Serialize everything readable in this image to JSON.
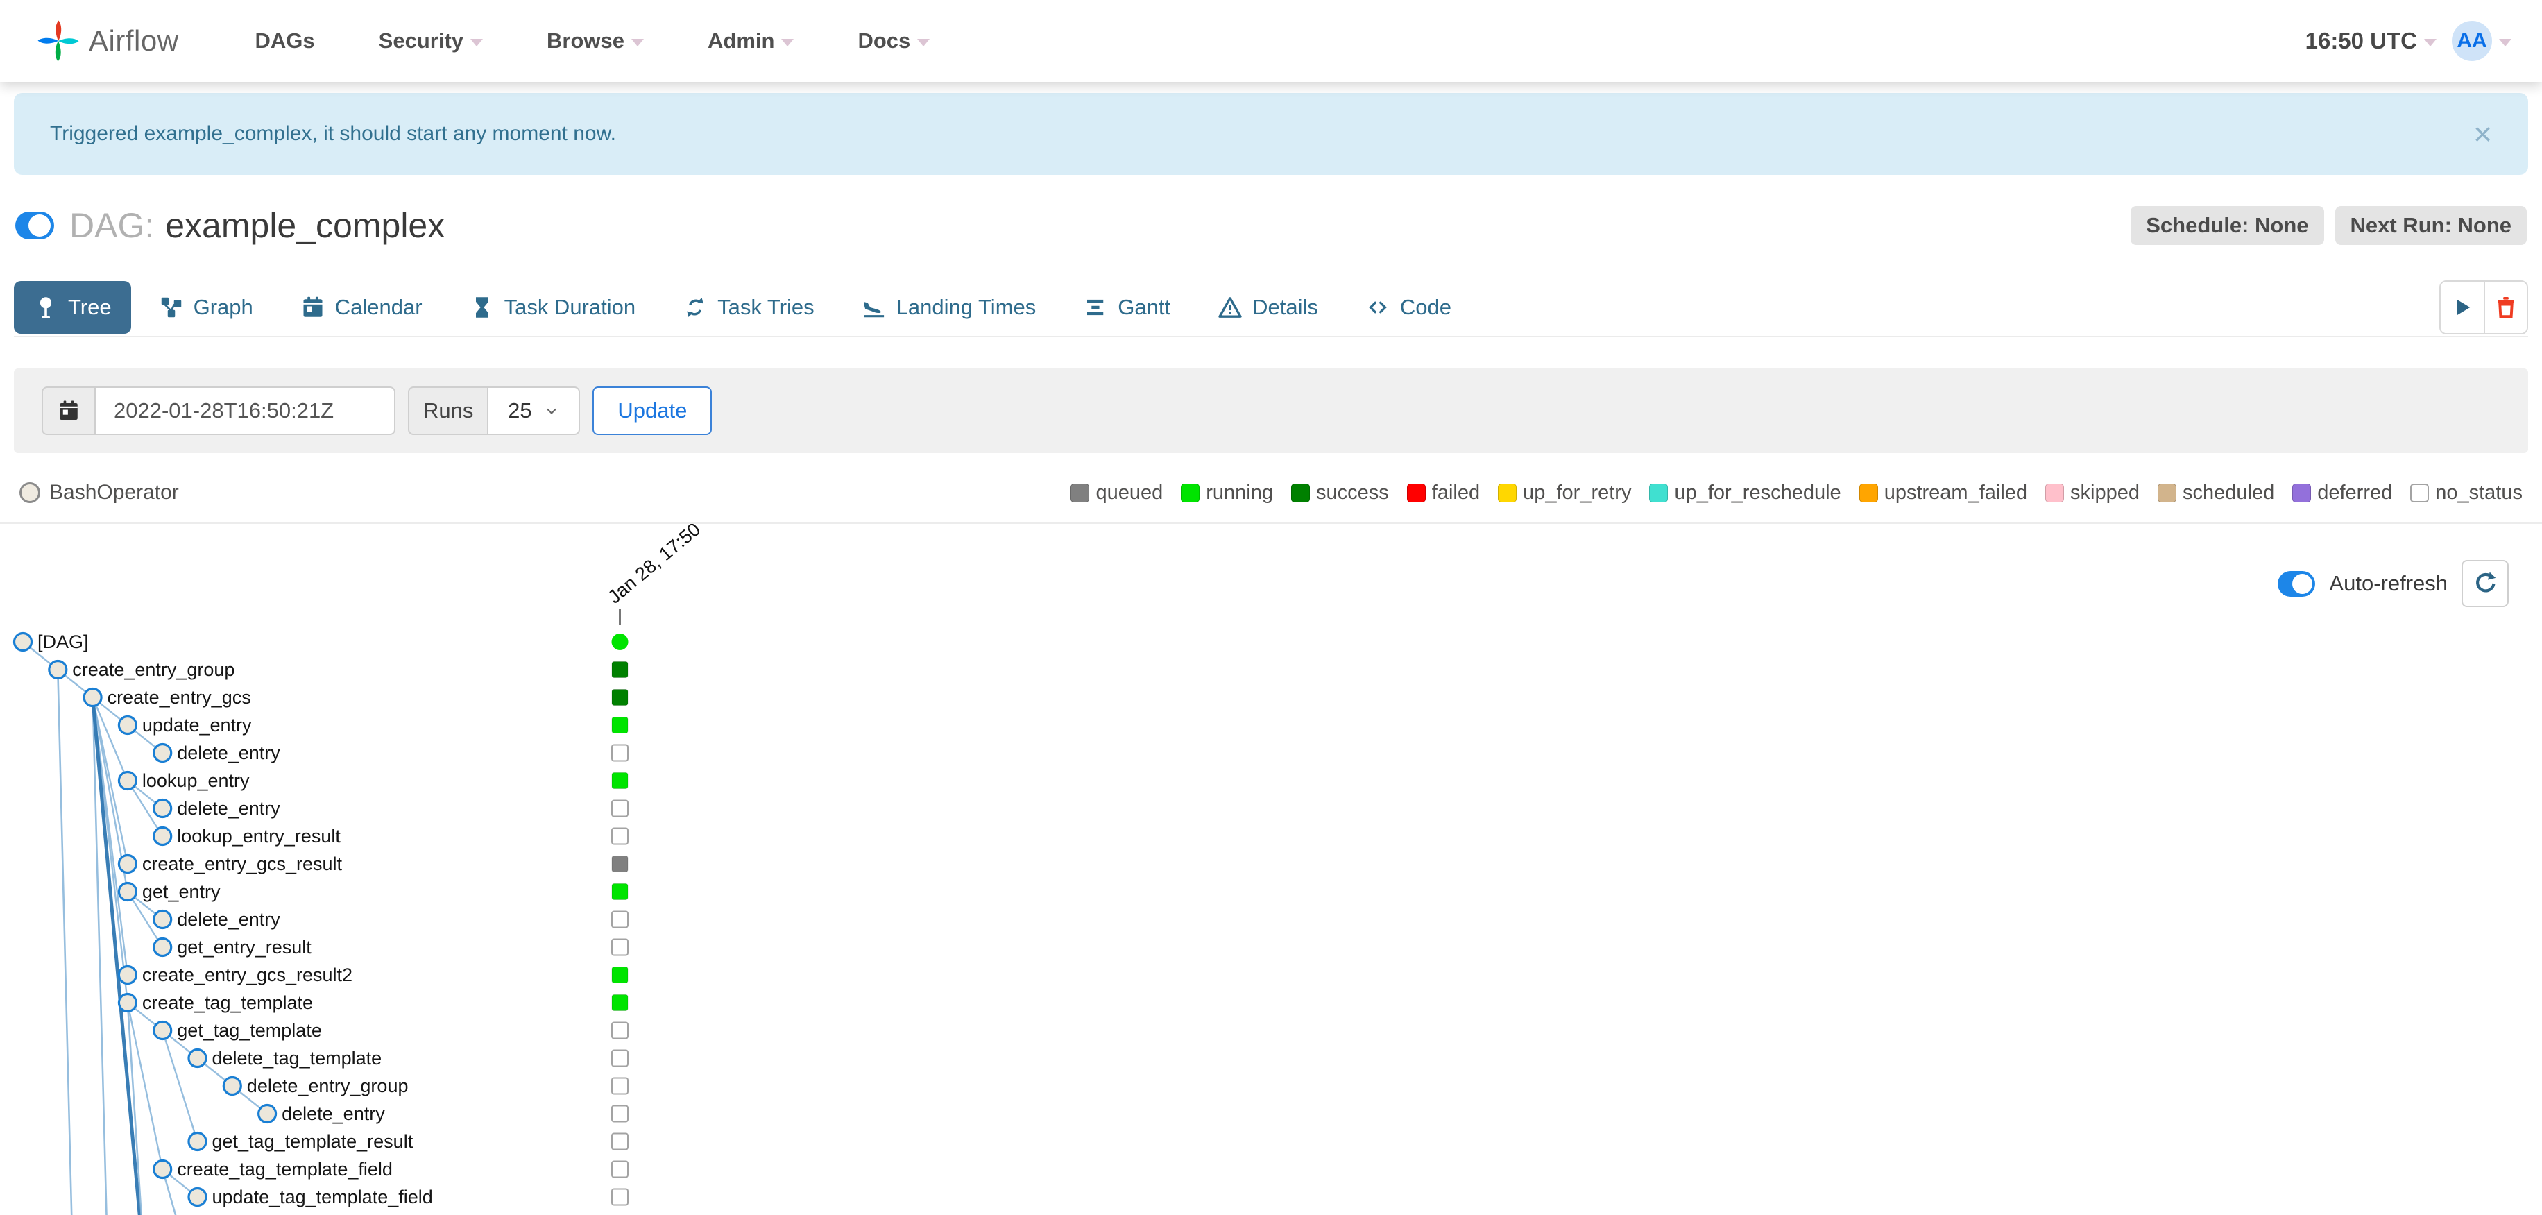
{
  "navbar": {
    "brand": "Airflow",
    "menus": [
      {
        "label": "DAGs",
        "caret": false
      },
      {
        "label": "Security",
        "caret": true
      },
      {
        "label": "Browse",
        "caret": true
      },
      {
        "label": "Admin",
        "caret": true
      },
      {
        "label": "Docs",
        "caret": true
      }
    ],
    "clock": "16:50 UTC",
    "avatar_initials": "AA"
  },
  "alert": {
    "message": "Triggered example_complex, it should start any moment now.",
    "close_glyph": "×"
  },
  "dag_header": {
    "prefix": "DAG:",
    "name": "example_complex",
    "badges": [
      {
        "label": "Schedule: None"
      },
      {
        "label": "Next Run: None"
      }
    ]
  },
  "tabs": [
    {
      "label": "Tree",
      "icon": "tree-pin-icon",
      "active": true
    },
    {
      "label": "Graph",
      "icon": "graph-icon",
      "active": false
    },
    {
      "label": "Calendar",
      "icon": "calendar-icon",
      "active": false
    },
    {
      "label": "Task Duration",
      "icon": "hourglass-icon",
      "active": false
    },
    {
      "label": "Task Tries",
      "icon": "retry-arrows-icon",
      "active": false
    },
    {
      "label": "Landing Times",
      "icon": "plane-landing-icon",
      "active": false
    },
    {
      "label": "Gantt",
      "icon": "gantt-bars-icon",
      "active": false
    },
    {
      "label": "Details",
      "icon": "warning-triangle-icon",
      "active": false
    },
    {
      "label": "Code",
      "icon": "code-brackets-icon",
      "active": false
    }
  ],
  "filter": {
    "date_value": "2022-01-28T16:50:21Z",
    "runs_label": "Runs",
    "runs_value": "25",
    "update_label": "Update"
  },
  "legend": {
    "operators": [
      {
        "label": "BashOperator",
        "fill": "#f0ebe1",
        "stroke": "#8b8b8b"
      }
    ],
    "statuses": [
      {
        "label": "queued",
        "color": "#808080"
      },
      {
        "label": "running",
        "color": "#00e400"
      },
      {
        "label": "success",
        "color": "#008000"
      },
      {
        "label": "failed",
        "color": "#ff0000"
      },
      {
        "label": "up_for_retry",
        "color": "#ffd700"
      },
      {
        "label": "up_for_reschedule",
        "color": "#40e0d0"
      },
      {
        "label": "upstream_failed",
        "color": "#ffa500"
      },
      {
        "label": "skipped",
        "color": "#ffc0cb"
      },
      {
        "label": "scheduled",
        "color": "#d2b48c"
      },
      {
        "label": "deferred",
        "color": "#9370db"
      },
      {
        "label": "no_status",
        "color": "#ffffff"
      }
    ]
  },
  "tree": {
    "auto_refresh_label": "Auto-refresh",
    "column_date": "Jan 28, 17:50",
    "dag_run_status": "running",
    "nodes": [
      {
        "label": "[DAG]",
        "level": 0,
        "status": "running",
        "hidden_children": false
      },
      {
        "label": "create_entry_group",
        "level": 1,
        "status": "success",
        "hidden_children": true
      },
      {
        "label": "create_entry_gcs",
        "level": 2,
        "status": "success",
        "hidden_children": true
      },
      {
        "label": "update_entry",
        "level": 3,
        "status": "running",
        "hidden_children": false
      },
      {
        "label": "delete_entry",
        "level": 4,
        "status": "no_status",
        "hidden_children": false
      },
      {
        "label": "lookup_entry",
        "level": 3,
        "status": "running",
        "hidden_children": false
      },
      {
        "label": "delete_entry",
        "level": 4,
        "status": "no_status",
        "hidden_children": false
      },
      {
        "label": "lookup_entry_result",
        "level": 4,
        "status": "no_status",
        "hidden_children": false
      },
      {
        "label": "create_entry_gcs_result",
        "level": 3,
        "status": "queued",
        "hidden_children": false
      },
      {
        "label": "get_entry",
        "level": 3,
        "status": "running",
        "hidden_children": false
      },
      {
        "label": "delete_entry",
        "level": 4,
        "status": "no_status",
        "hidden_children": false
      },
      {
        "label": "get_entry_result",
        "level": 4,
        "status": "no_status",
        "hidden_children": false
      },
      {
        "label": "create_entry_gcs_result2",
        "level": 3,
        "status": "running",
        "hidden_children": false
      },
      {
        "label": "create_tag_template",
        "level": 3,
        "status": "running",
        "hidden_children": true
      },
      {
        "label": "get_tag_template",
        "level": 4,
        "status": "no_status",
        "hidden_children": false
      },
      {
        "label": "delete_tag_template",
        "level": 5,
        "status": "no_status",
        "hidden_children": false
      },
      {
        "label": "delete_entry_group",
        "level": 6,
        "status": "no_status",
        "hidden_children": false
      },
      {
        "label": "delete_entry",
        "level": 7,
        "status": "no_status",
        "hidden_children": false
      },
      {
        "label": "get_tag_template_result",
        "level": 5,
        "status": "no_status",
        "hidden_children": false
      },
      {
        "label": "create_tag_template_field",
        "level": 4,
        "status": "no_status",
        "hidden_children": true
      },
      {
        "label": "update_tag_template_field",
        "level": 5,
        "status": "no_status",
        "hidden_children": false
      }
    ]
  },
  "colors": {
    "node_fill": "#ece7db",
    "node_stroke": "#1a7fd4",
    "edge": "#84b3d9",
    "edge_dark": "#2f77b2",
    "toggle_on": "#1d86e8",
    "tab_active_bg": "#3c6d91",
    "alert_bg": "#d9edf7",
    "alert_text": "#31708f",
    "no_status_border": "#a3a3a3"
  }
}
